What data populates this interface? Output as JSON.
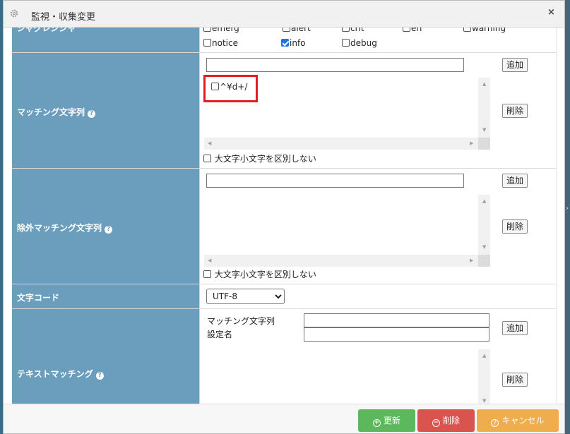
{
  "dialog": {
    "title": "監視・収集変更",
    "close_glyph": "×"
  },
  "levels": {
    "label": "ジャグレジシャ",
    "row1": [
      "emerg",
      "alert",
      "crit",
      "err",
      "warning"
    ],
    "row2": [
      {
        "label": "notice",
        "checked": false
      },
      {
        "label": "info",
        "checked": true
      },
      {
        "label": "debug",
        "checked": false
      }
    ]
  },
  "matching": {
    "label": "マッチング文字列",
    "input_value": "",
    "add_label": "追加",
    "delete_label": "削除",
    "items": [
      {
        "label": "^¥d+/",
        "checked": false
      }
    ],
    "ignore_case_label": "大文字小文字を区別しない"
  },
  "exclude": {
    "label": "除外マッチング文字列",
    "input_value": "",
    "add_label": "追加",
    "delete_label": "削除",
    "ignore_case_label": "大文字小文字を区別しない"
  },
  "encoding": {
    "label": "文字コード",
    "selected": "UTF-8"
  },
  "text_matching": {
    "label": "テキストマッチング",
    "field1_label": "マッチング文字列",
    "field2_label": "設定名",
    "add_label": "追加",
    "delete_label": "削除"
  },
  "footer": {
    "update_label": "更新",
    "delete_label": "削除",
    "cancel_label": "キャンセル",
    "colors": {
      "update": "#5cb85c",
      "delete": "#d9534f",
      "cancel": "#f0ad4e"
    }
  }
}
